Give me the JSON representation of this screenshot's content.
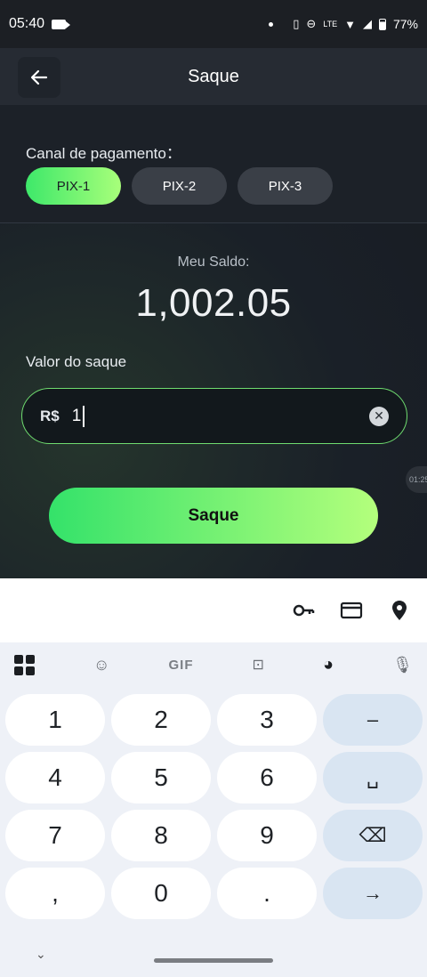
{
  "status": {
    "time": "05:40",
    "battery": "77%",
    "network": "LTE"
  },
  "header": {
    "title": "Saque"
  },
  "payment": {
    "label": "Canal de pagamento：",
    "channels": [
      "PIX-1",
      "PIX-2",
      "PIX-3"
    ],
    "selected": "PIX-1"
  },
  "balance": {
    "label": "Meu Saldo:",
    "value": "1,002.05"
  },
  "withdraw": {
    "label": "Valor do saque",
    "currency": "R$",
    "value": "1",
    "side_time": "01:25",
    "button_label": "Saque"
  },
  "keyboard": {
    "toolbar": {
      "gif_label": "GIF"
    },
    "keys": [
      "1",
      "2",
      "3",
      "–",
      "4",
      "5",
      "6",
      "␣",
      "7",
      "8",
      "9",
      "⌫",
      ",",
      "0",
      ".",
      "→"
    ]
  },
  "colors": {
    "accent_green": "#3ee86a",
    "background": "#1b1f25"
  }
}
